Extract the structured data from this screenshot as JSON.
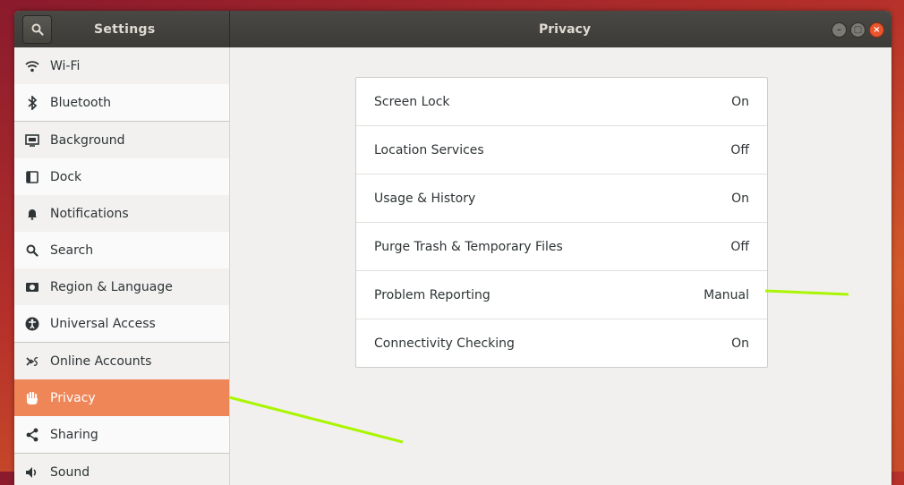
{
  "header": {
    "sidebar_title": "Settings",
    "page_title": "Privacy"
  },
  "sidebar": {
    "items": [
      {
        "label": "Wi-Fi",
        "icon": "wifi-icon"
      },
      {
        "label": "Bluetooth",
        "icon": "bluetooth-icon"
      },
      {
        "label": "Background",
        "icon": "background-icon"
      },
      {
        "label": "Dock",
        "icon": "dock-icon"
      },
      {
        "label": "Notifications",
        "icon": "bell-icon"
      },
      {
        "label": "Search",
        "icon": "search-icon"
      },
      {
        "label": "Region & Language",
        "icon": "region-icon"
      },
      {
        "label": "Universal Access",
        "icon": "accessibility-icon"
      },
      {
        "label": "Online Accounts",
        "icon": "online-accounts-icon"
      },
      {
        "label": "Privacy",
        "icon": "hand-icon"
      },
      {
        "label": "Sharing",
        "icon": "share-icon"
      },
      {
        "label": "Sound",
        "icon": "speaker-icon"
      }
    ],
    "active": "Privacy"
  },
  "privacy": {
    "rows": [
      {
        "label": "Screen Lock",
        "value": "On"
      },
      {
        "label": "Location Services",
        "value": "Off"
      },
      {
        "label": "Usage & History",
        "value": "On"
      },
      {
        "label": "Purge Trash & Temporary Files",
        "value": "Off"
      },
      {
        "label": "Problem Reporting",
        "value": "Manual"
      },
      {
        "label": "Connectivity Checking",
        "value": "On"
      }
    ]
  },
  "colors": {
    "accent": "#ef8658",
    "titlebar": "#3c3b37",
    "annotation": "#aaf500"
  }
}
